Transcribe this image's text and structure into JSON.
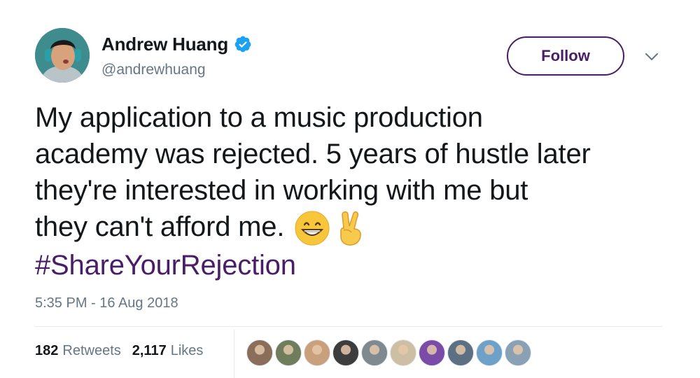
{
  "user": {
    "display_name": "Andrew Huang",
    "handle": "@andrewhuang",
    "verified": true
  },
  "follow_label": "Follow",
  "tweet": {
    "text_lines": [
      "My application to a music production",
      "academy was rejected. 5 years of hustle later",
      "they're interested in working with me but",
      "they can't afford me."
    ],
    "emojis": [
      "grinning-face-emoji",
      "victory-hand-emoji"
    ],
    "hashtag": "#ShareYourRejection",
    "timestamp": "5:35 PM - 16 Aug 2018"
  },
  "stats": {
    "retweets_count": "182",
    "retweets_label": "Retweets",
    "likes_count": "2,117",
    "likes_label": "Likes"
  },
  "likers": [
    {
      "color": "#8a6e5a"
    },
    {
      "color": "#6f7d5c"
    },
    {
      "color": "#c8a07c"
    },
    {
      "color": "#3d3d3d"
    },
    {
      "color": "#7e8a8f"
    },
    {
      "color": "#cdbfa3"
    },
    {
      "color": "#7b4ba8"
    },
    {
      "color": "#5d6f82"
    },
    {
      "color": "#6fa0c8"
    },
    {
      "color": "#8aa0b4"
    }
  ],
  "colors": {
    "accent": "#4a1d68",
    "verified": "#1da1f2",
    "secondary_text": "#657786"
  }
}
